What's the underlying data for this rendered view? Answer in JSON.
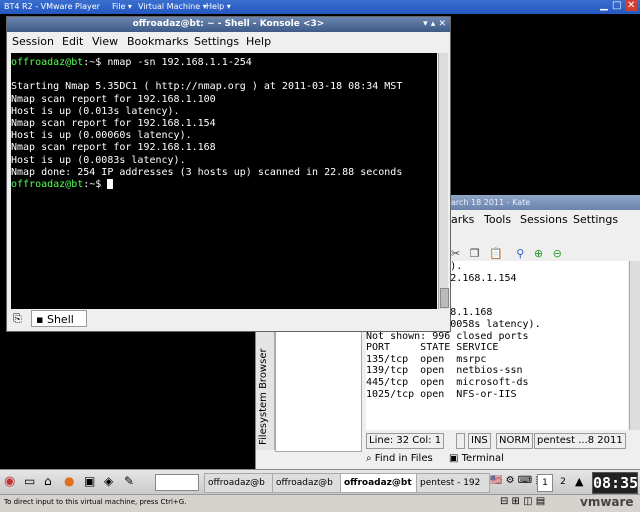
{
  "vm": {
    "title": "BT4 R2 - VMware Player",
    "menus": [
      "File ▾",
      "Virtual Machine ▾",
      "Help ▾"
    ],
    "status_hint": "To direct input to this virtual machine, press Ctrl+G.",
    "brand": "vmware"
  },
  "konsole": {
    "title": "offroadaz@bt: ~ - Shell - Konsole <3>",
    "menu": [
      "Session",
      "Edit",
      "View",
      "Bookmarks",
      "Settings",
      "Help"
    ],
    "prompt": "offroadaz@bt",
    "lines": [
      {
        "prompt": "offroadaz@bt",
        "rest": ":~$ nmap -sn 192.168.1.1-254"
      },
      {
        "text": ""
      },
      {
        "text": "Starting Nmap 5.35DC1 ( http://nmap.org ) at 2011-03-18 08:34 MST"
      },
      {
        "text": "Nmap scan report for 192.168.1.100"
      },
      {
        "text": "Host is up (0.013s latency)."
      },
      {
        "text": "Nmap scan report for 192.168.1.154"
      },
      {
        "text": "Host is up (0.00060s latency)."
      },
      {
        "text": "Nmap scan report for 192.168.1.168"
      },
      {
        "text": "Host is up (0.0083s latency)."
      },
      {
        "text": "Nmap done: 254 IP addresses (3 hosts up) scanned in 22.88 seconds"
      },
      {
        "prompt": "offroadaz@bt",
        "rest": ":~$ "
      }
    ],
    "tab_label": "Shell"
  },
  "kate": {
    "title": "arch 18 2011 - Kate",
    "menu": [
      "arks",
      "Tools",
      "Sessions",
      "Settings"
    ],
    "side_panel": "Filesystem Browser",
    "lines": [
      "00092s latency).",
      "ed ports on 192.168.1.154",
      "",
      "",
      "ort for 192.168.1.168",
      "Host is up (0.0058s latency).",
      "Not shown: 996 closed ports",
      "PORT     STATE SERVICE",
      "135/tcp  open  msrpc",
      "139/tcp  open  netbios-ssn",
      "445/tcp  open  microsoft-ds",
      "1025/tcp open  NFS-or-IIS",
      ""
    ],
    "status": {
      "position": "Line: 32 Col: 1",
      "ins": "INS",
      "mode": "NORM",
      "file": "pentest ...8 2011"
    },
    "bottom_tabs": [
      "Find in Files",
      "Terminal"
    ]
  },
  "taskbar": {
    "tasks": [
      "offroadaz@b",
      "offroadaz@b",
      "offroadaz@bt",
      "pentest - 192"
    ],
    "pages": [
      "1",
      "2"
    ],
    "clock": "08:35"
  }
}
